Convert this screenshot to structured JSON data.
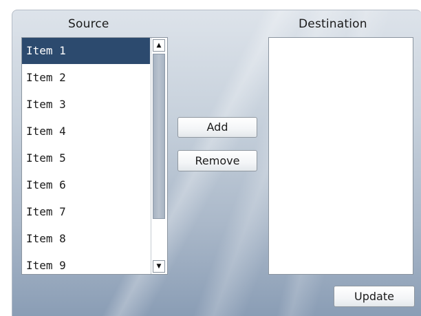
{
  "source": {
    "label": "Source",
    "items": [
      "Item 1",
      "Item 2",
      "Item 3",
      "Item 4",
      "Item 5",
      "Item 6",
      "Item 7",
      "Item 8",
      "Item 9"
    ],
    "selected": "Item 1",
    "scroll_up_icon": "▲",
    "scroll_down_icon": "▼"
  },
  "destination": {
    "label": "Destination",
    "items": []
  },
  "buttons": {
    "add": "Add",
    "remove": "Remove",
    "update": "Update"
  },
  "colors": {
    "selection": "#2c4a6e",
    "panel_top": "#dde3ea",
    "panel_bottom": "#8a9db5"
  }
}
